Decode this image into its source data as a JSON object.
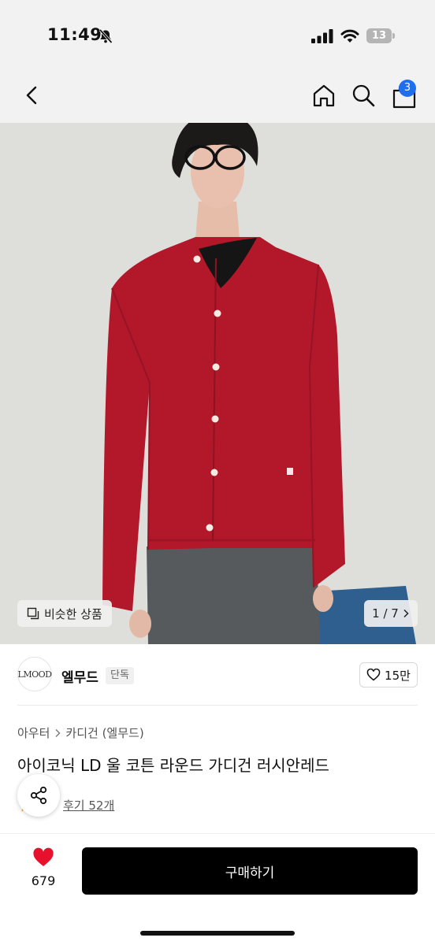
{
  "status_bar": {
    "time": "11:49",
    "battery": "13"
  },
  "nav": {
    "cart_count": "3"
  },
  "gallery": {
    "similar_label": "비슷한 상품",
    "counter": "1 / 7"
  },
  "brand": {
    "logo_text": "LMOOD",
    "name": "엘무드",
    "tag": "단독",
    "likes": "15만"
  },
  "product": {
    "breadcrumb": [
      "아우터",
      "카디건 (엘무드)"
    ],
    "title": "아이코닉 LD 울 코튼 라운드 가디건 러시안레드",
    "reviews": "후기 52개"
  },
  "bottom_bar": {
    "wish_count": "679",
    "buy_label": "구매하기"
  },
  "colors": {
    "badge": "#1f6ef0",
    "heart": "#e8112d",
    "buy_button": "#000000",
    "cardigan": "#b3172a"
  }
}
